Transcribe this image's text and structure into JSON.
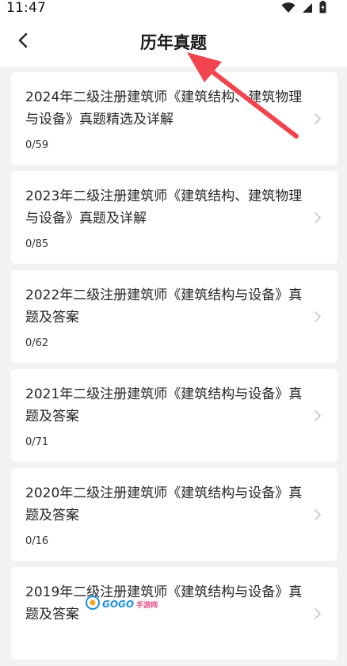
{
  "status_bar": {
    "time": "11:47"
  },
  "header": {
    "title": "历年真题"
  },
  "papers": [
    {
      "title": "2024年二级注册建筑师《建筑结构、建筑物理与设备》真题精选及详解",
      "progress": "0/59"
    },
    {
      "title": "2023年二级注册建筑师《建筑结构、建筑物理与设备》真题及详解",
      "progress": "0/85"
    },
    {
      "title": "2022年二级注册建筑师《建筑结构与设备》真题及答案",
      "progress": "0/62"
    },
    {
      "title": "2021年二级注册建筑师《建筑结构与设备》真题及答案",
      "progress": "0/71"
    },
    {
      "title": "2020年二级注册建筑师《建筑结构与设备》真题及答案",
      "progress": "0/16"
    },
    {
      "title": "2019年二级注册建筑师《建筑结构与设备》真题及答案",
      "progress": ""
    }
  ],
  "watermark": {
    "brand": "GOGO",
    "sub": "手游网"
  },
  "colors": {
    "background": "#f2f2f2",
    "card": "#ffffff",
    "annotation_arrow": "#f0444e"
  }
}
